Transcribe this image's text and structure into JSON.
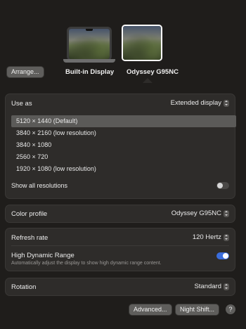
{
  "displays": {
    "arrange_label": "Arrange...",
    "builtin_label": "Built-in Display",
    "selected_label": "Odyssey G95NC"
  },
  "use_as": {
    "label": "Use as",
    "value": "Extended display"
  },
  "resolutions": {
    "items": [
      "5120 × 1440 (Default)",
      "3840 × 2160 (low resolution)",
      "3840 × 1080",
      "2560 × 720",
      "1920 × 1080 (low resolution)"
    ],
    "selected_index": 0,
    "show_all_label": "Show all resolutions",
    "show_all_enabled": false
  },
  "color_profile": {
    "label": "Color profile",
    "value": "Odyssey G95NC"
  },
  "refresh_rate": {
    "label": "Refresh rate",
    "value": "120 Hertz"
  },
  "hdr": {
    "label": "High Dynamic Range",
    "description": "Automatically adjust the display to show high dynamic range content.",
    "enabled": true
  },
  "rotation": {
    "label": "Rotation",
    "value": "Standard"
  },
  "footer": {
    "advanced_label": "Advanced...",
    "night_shift_label": "Night Shift...",
    "help_label": "?"
  },
  "colors": {
    "background": "#1f1d1b",
    "panel": "#2e2c2a",
    "accent": "#3a6ddc",
    "selection": "#5b5a58"
  }
}
